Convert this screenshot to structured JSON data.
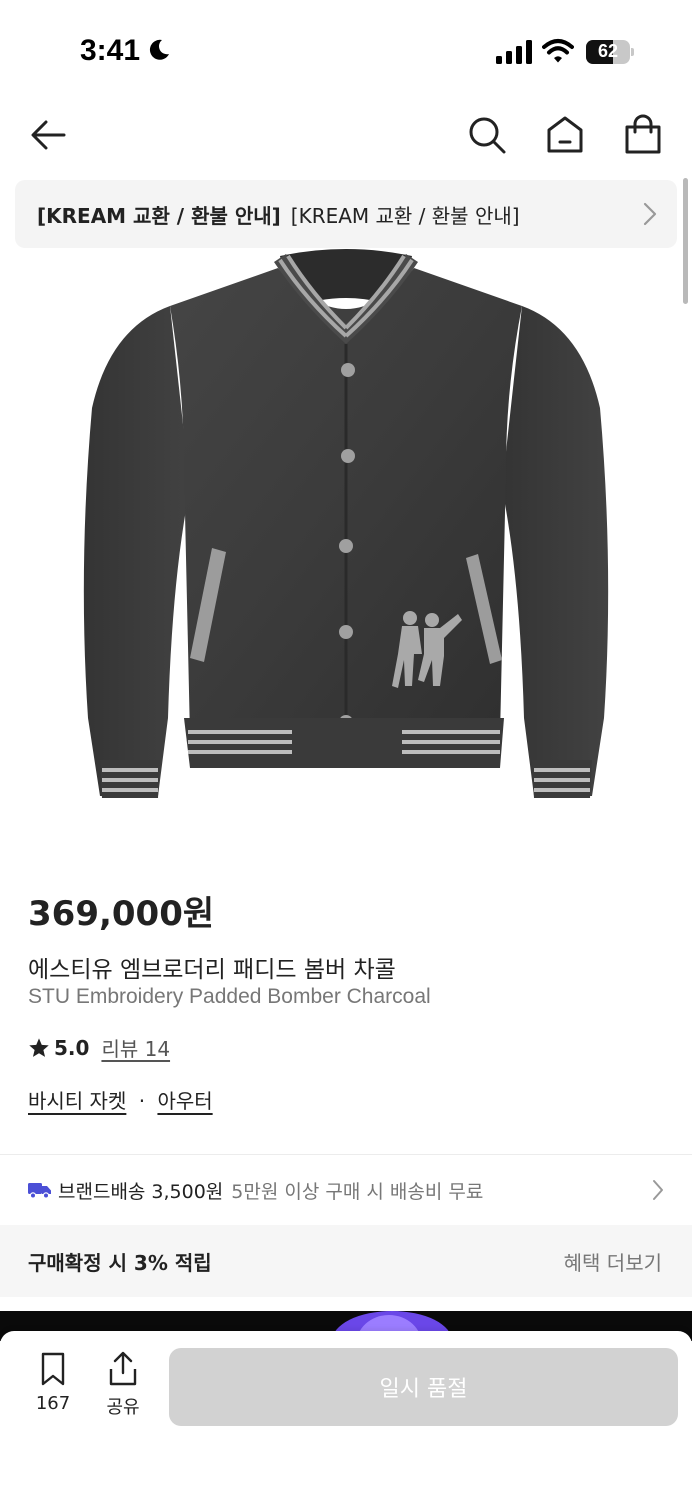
{
  "status_bar": {
    "time": "3:41",
    "battery_level": "62",
    "icons": [
      "moon-icon",
      "cellular-signal-icon",
      "wifi-icon",
      "battery-icon"
    ]
  },
  "nav": {
    "icons": [
      "back-arrow-icon",
      "search-icon",
      "home-icon",
      "shopping-bag-icon"
    ]
  },
  "notice": {
    "bold_text": "[KREAM 교환 / 환불 안내]",
    "text": "[KREAM 교환 / 환불 안내]"
  },
  "product": {
    "image_subject": "charcoal wool varsity bomber jacket with striped rib collar and cuffs",
    "price": "369,000원",
    "name_ko": "에스티유 엠브로더리 패디드 봄버 차콜",
    "name_en": "STU Embroidery Padded Bomber Charcoal",
    "rating": "5.0",
    "review_label": "리뷰 14",
    "category_primary": "바시티 자켓",
    "category_separator": "·",
    "category_secondary": "아우터"
  },
  "shipping": {
    "label": "브랜드배송",
    "price": "3,500원",
    "description": "5만원 이상 구매 시 배송비 무료"
  },
  "benefit": {
    "text": "구매확정 시 3% 적립",
    "more_label": "혜택 더보기"
  },
  "bottom_bar": {
    "bookmark_count": "167",
    "share_label": "공유",
    "soldout_label": "일시 품절"
  },
  "colors": {
    "text_primary": "#222222",
    "text_secondary": "#777777",
    "disabled_button": "#d2d2d2",
    "truck_icon": "#4b4fd6",
    "panel_background": "#f4f4f4"
  }
}
